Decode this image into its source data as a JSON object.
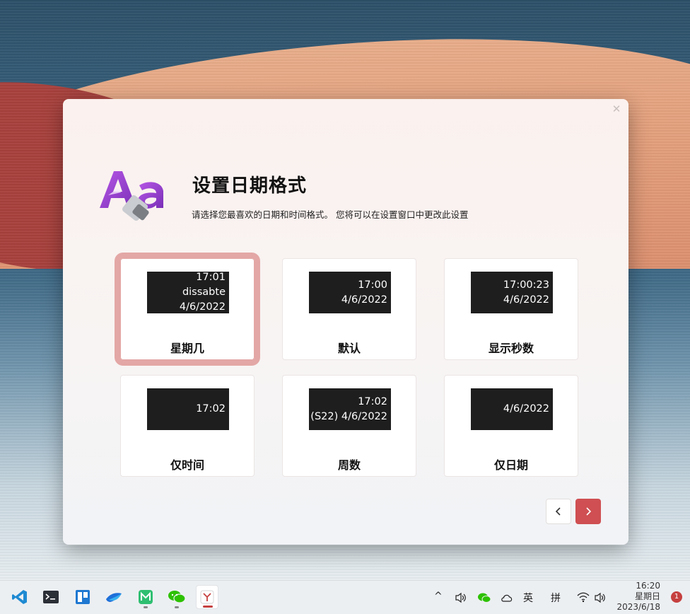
{
  "dialog": {
    "title": "设置日期格式",
    "subtitle": "请选择您最喜欢的日期和时间格式。 您将可以在设置窗口中更改此设置",
    "close_glyph": "✕",
    "accent_color": "#cf4f52",
    "selected_border_color": "#e3a7a5",
    "options": [
      {
        "label": "星期几",
        "preview_lines": [
          "17:01",
          "dissabte",
          "4/6/2022"
        ],
        "selected": true
      },
      {
        "label": "默认",
        "preview_lines": [
          "17:00",
          "4/6/2022"
        ],
        "selected": false
      },
      {
        "label": "显示秒数",
        "preview_lines": [
          "17:00:23",
          "4/6/2022"
        ],
        "selected": false
      },
      {
        "label": "仅时间",
        "preview_lines": [
          "17:02"
        ],
        "selected": false
      },
      {
        "label": "周数",
        "preview_lines": [
          "17:02",
          "(S22) 4/6/2022"
        ],
        "selected": false
      },
      {
        "label": "仅日期",
        "preview_lines": [
          "4/6/2022"
        ],
        "selected": false
      }
    ],
    "nav": {
      "prev_icon": "chevron-left-icon",
      "next_icon": "chevron-right-icon"
    }
  },
  "taskbar": {
    "apps": [
      {
        "name": "vscode-icon"
      },
      {
        "name": "terminal-icon"
      },
      {
        "name": "board-app-icon"
      },
      {
        "name": "bird-app-icon"
      },
      {
        "name": "maps-app-icon"
      },
      {
        "name": "wechat-icon"
      },
      {
        "name": "app-y-icon"
      }
    ],
    "tray": {
      "chevron": "^",
      "lang": "英",
      "ime": "拼",
      "time": "16:20",
      "weekday": "星期日",
      "date": "2023/6/18",
      "notification_count": "1"
    }
  }
}
